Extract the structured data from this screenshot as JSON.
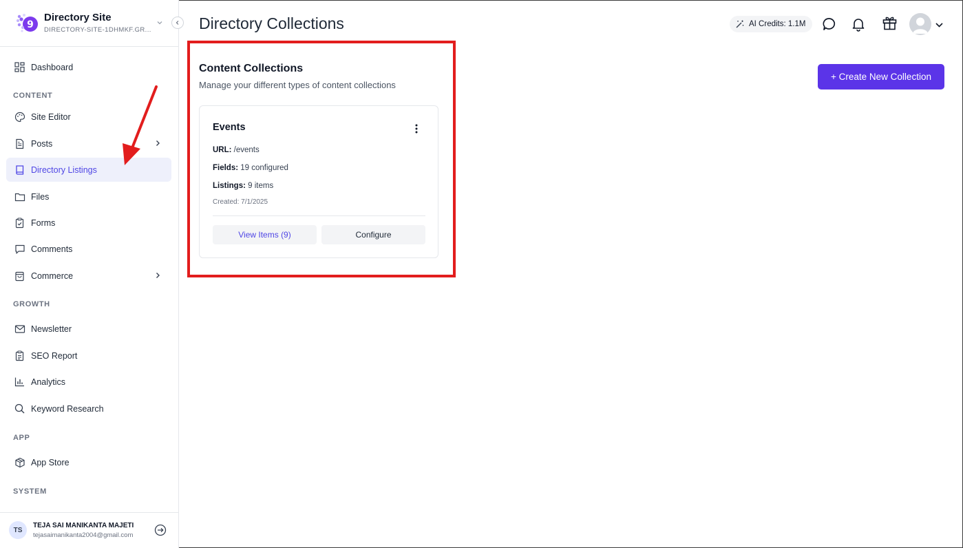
{
  "sidebar": {
    "site_title": "Directory Site",
    "site_id": "DIRECTORY-SITE-1DHMKF.GR...",
    "dashboard": "Dashboard",
    "sections": {
      "content": "CONTENT",
      "growth": "GROWTH",
      "app": "APP",
      "system": "SYSTEM"
    },
    "items": {
      "site_editor": "Site Editor",
      "posts": "Posts",
      "directory_listings": "Directory Listings",
      "files": "Files",
      "forms": "Forms",
      "comments": "Comments",
      "commerce": "Commerce",
      "newsletter": "Newsletter",
      "seo_report": "SEO Report",
      "analytics": "Analytics",
      "keyword_research": "Keyword Research",
      "app_store": "App Store"
    },
    "active_item": "Directory Listings",
    "user": {
      "initials": "TS",
      "name": "TEJA SAI MANIKANTA MAJETI",
      "email": "tejasaimanikanta2004@gmail.com"
    }
  },
  "header": {
    "title": "Directory Collections",
    "ai_credits": "AI Credits: 1.1M",
    "icons": [
      "magic-wand-icon",
      "chat-icon",
      "bell-icon",
      "gift-icon",
      "avatar",
      "chevron-down-icon"
    ]
  },
  "main": {
    "section_title": "Content Collections",
    "section_desc": "Manage your different types of content collections",
    "create_button": "+ Create New Collection",
    "collection": {
      "name": "Events",
      "url_label": "URL:",
      "url_value": "/events",
      "fields_label": "Fields:",
      "fields_value": "19 configured",
      "listings_label": "Listings:",
      "listings_value": "9 items",
      "created": "Created: 7/1/2025",
      "view_button": "View Items (9)",
      "configure_button": "Configure"
    }
  },
  "colors": {
    "accent": "#5b34e8",
    "active_bg": "#eef0fb",
    "active_text": "#4f46e5",
    "annotation_red": "#e21d1d"
  }
}
